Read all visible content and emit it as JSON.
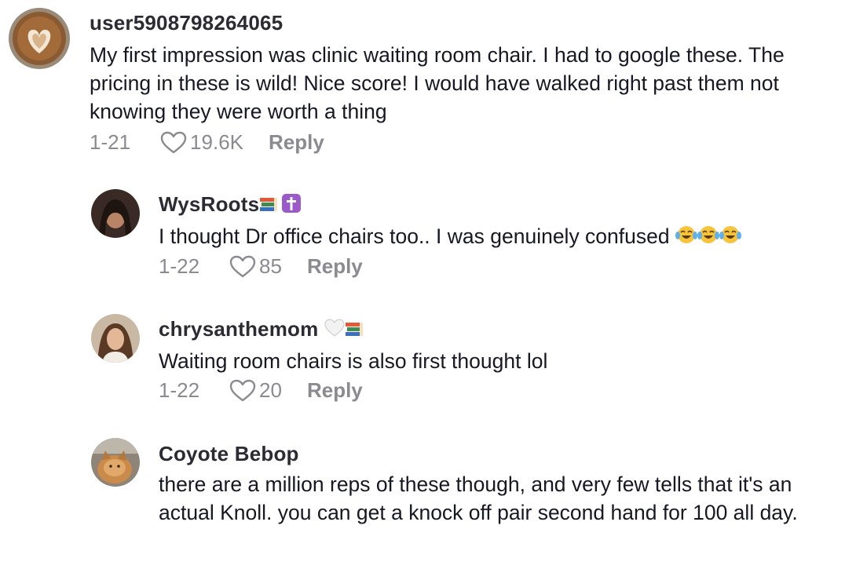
{
  "comments": [
    {
      "username": "user5908798264065",
      "text": "My first impression was clinic waiting room chair. I had to google these. The pricing in these is wild! Nice score! I would have walked right past them not knowing they were worth a thing",
      "date": "1-21",
      "likes": "19.6K",
      "reply_label": "Reply",
      "avatar_icon": "latte-art-avatar"
    },
    {
      "username": "WysRoots",
      "username_emojis": [
        "books-emoji",
        "latin-cross-emoji"
      ],
      "text": "I thought Dr office chairs too.. I was genuinely confused",
      "text_emojis": [
        "tears-of-joy-emoji",
        "tears-of-joy-emoji",
        "tears-of-joy-emoji"
      ],
      "date": "1-22",
      "likes": "85",
      "reply_label": "Reply",
      "avatar_icon": "person-avatar"
    },
    {
      "username": "chrysanthemom",
      "username_emojis": [
        "white-heart-emoji",
        "books-emoji"
      ],
      "text": "Waiting room chairs is also first thought lol",
      "date": "1-22",
      "likes": "20",
      "reply_label": "Reply",
      "avatar_icon": "person-avatar"
    },
    {
      "username": "Coyote Bebop",
      "text": "there are a million reps of these though, and very few tells that it's an actual Knoll. you can get a knock off pair second hand for 100 all day.",
      "avatar_icon": "cat-avatar"
    }
  ],
  "colors": {
    "username": "#2a2b33",
    "text": "#161823",
    "meta": "#8a8b91"
  }
}
